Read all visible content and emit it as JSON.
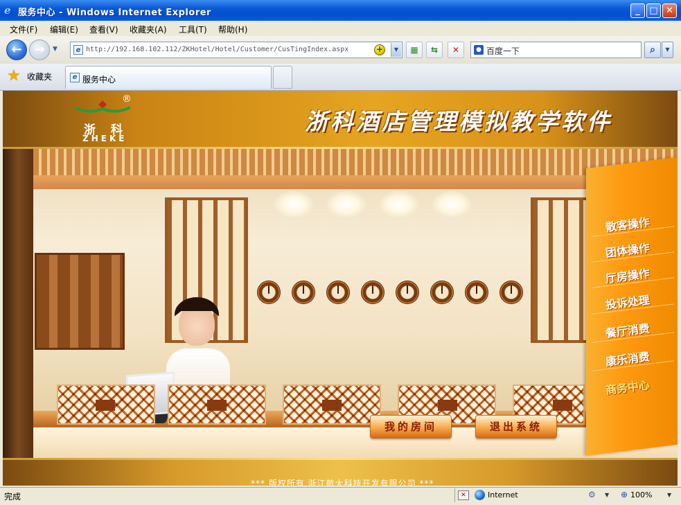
{
  "window": {
    "title": "服务中心 - Windows Internet Explorer",
    "minimize": "_",
    "maximize": "□",
    "close": "✕"
  },
  "menu": [
    "文件(F)",
    "编辑(E)",
    "查看(V)",
    "收藏夹(A)",
    "工具(T)",
    "帮助(H)"
  ],
  "address": {
    "url": "http://192.168.102.112/ZKHotel/Hotel/Customer/CusTingIndex.aspx"
  },
  "search": {
    "placeholder": "百度一下"
  },
  "favorites": {
    "label": "收藏夹"
  },
  "tab": {
    "label": "服务中心"
  },
  "page": {
    "logo": {
      "registered": "®",
      "chinese": "浙科",
      "english": "ZHEKE"
    },
    "app_title": "浙科酒店管理模拟教学软件",
    "side_menu": [
      "散客操作",
      "团体操作",
      "厅房操作",
      "投诉处理",
      "餐厅消费",
      "康乐消费",
      "商务中心"
    ],
    "active_side_item": "商务中心",
    "buttons": {
      "my_room": "我的房间",
      "logout": "退出系统"
    },
    "copyright": "*** 版权所有  浙江航大科技开发有限公司 ***"
  },
  "status": {
    "text": "完成",
    "zone": "Internet",
    "zoom": "100%"
  },
  "colors": {
    "banner_gold": "#e6a520",
    "side_menu_orange": "#ff9a10",
    "active_item": "#ffe680",
    "button_text": "#8a1d00"
  }
}
